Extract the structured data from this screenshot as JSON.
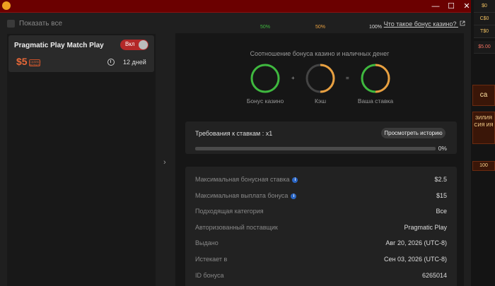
{
  "window": {
    "minimize": "—",
    "maximize": "☐",
    "close": "✕"
  },
  "sidebar_strip": {
    "items": [
      "$0",
      "C$0",
      "T$0",
      "$5.00"
    ],
    "promo1": "са",
    "promo2": "ЗИЛИЯ СИЯ ИЯ",
    "promo3": "100"
  },
  "toolbar": {
    "show_all": "Показать все",
    "what_is_bonus": "Что такое бонус казино?"
  },
  "bonus_card": {
    "title": "Pragmatic Play Match Play",
    "toggle_label": "Вкл",
    "amount": "$5",
    "badge": "CASINO BONUS",
    "days": "12 дней"
  },
  "ratio": {
    "title": "Соотношение бонуса казино и наличных денег",
    "bonus_pct": "50%",
    "cash_pct": "50%",
    "total_pct": "100%",
    "bonus_label": "Бонус казино",
    "cash_label": "Кэш",
    "stake_label": "Ваша ставка",
    "plus": "+",
    "equals": "=",
    "colors": {
      "bonus": "#3fb83f",
      "cash": "#e8a040",
      "track": "#444444"
    }
  },
  "wagering": {
    "title": "Требования к ставкам : x1",
    "history_button": "Просмотреть историю",
    "progress_pct": "0%",
    "progress_value": 0
  },
  "details": [
    {
      "label": "Максимальная бонусная ставка",
      "value": "$2.5",
      "info": true
    },
    {
      "label": "Максимальная выплата бонуса",
      "value": "$15",
      "info": true
    },
    {
      "label": "Подходящая категория",
      "value": "Все",
      "info": false
    },
    {
      "label": "Авторизованный поставщик",
      "value": "Pragmatic Play",
      "info": false
    },
    {
      "label": "Выдано",
      "value": "Авг 20, 2026 (UTC-8)",
      "info": false
    },
    {
      "label": "Истекает в",
      "value": "Сен 03, 2026 (UTC-8)",
      "info": false
    },
    {
      "label": "ID бонуса",
      "value": "6265014",
      "info": false
    }
  ]
}
